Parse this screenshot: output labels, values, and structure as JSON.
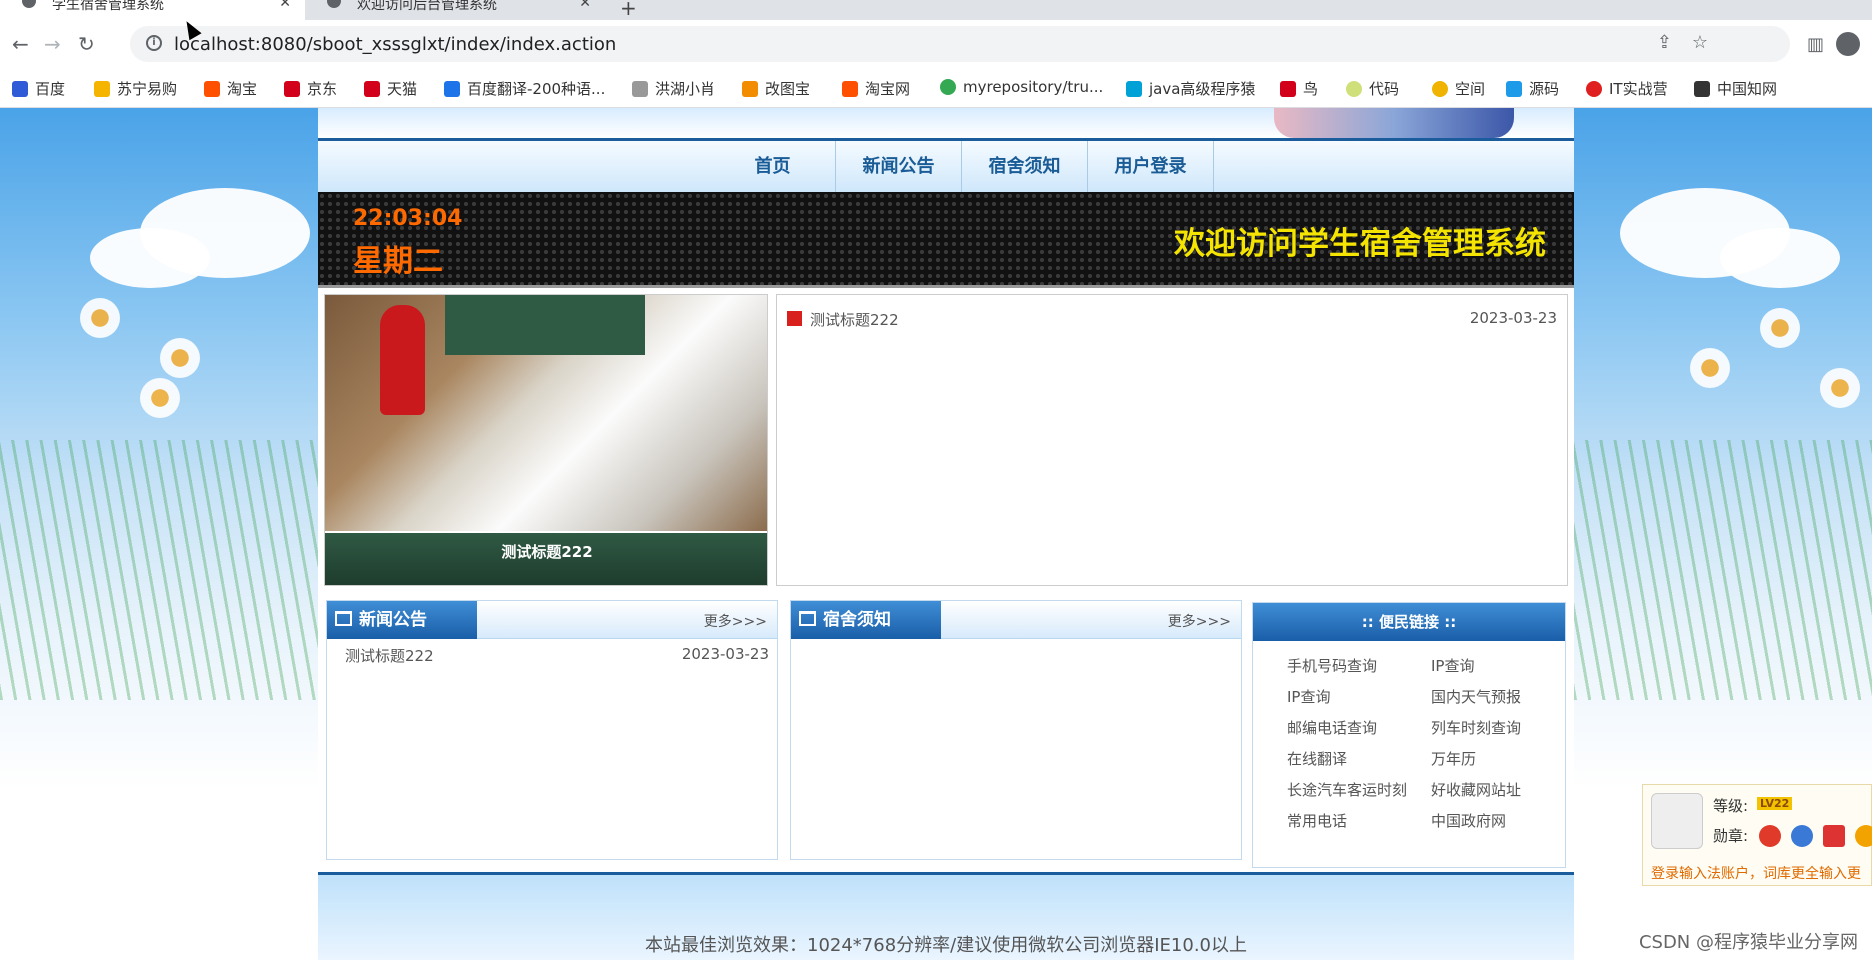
{
  "browser": {
    "tabs": [
      {
        "title": "学生宿舍管理系统",
        "close": "✕"
      },
      {
        "title": "欢迎访问后台管理系统",
        "close": "✕"
      }
    ],
    "newtab": "+",
    "url": "localhost:8080/sboot_xsssglxt/index/index.action",
    "bookmarks": [
      "百度",
      "苏宁易购",
      "淘宝",
      "京东",
      "天猫",
      "百度翻译-200种语...",
      "洪湖小肖",
      "改图宝",
      "淘宝网",
      "myrepository/tru...",
      "java高级程序猿",
      "鸟",
      "代码",
      "空间",
      "源码",
      "IT实战营",
      "中国知网"
    ]
  },
  "site": {
    "nav": [
      "首页",
      "新闻公告",
      "宿舍须知",
      "用户登录"
    ],
    "time": "22:03:04",
    "weekday": "星期二",
    "welcome": "欢迎访问学生宿舍管理系统",
    "slide_caption": "测试标题222",
    "top_news": {
      "title": "测试标题222",
      "date": "2023-03-23"
    },
    "news_box": {
      "title": "新闻公告",
      "more": "更多>>>",
      "items": [
        {
          "title": "测试标题222",
          "date": "2023-03-23"
        }
      ]
    },
    "notice_box": {
      "title": "宿舍须知",
      "more": "更多>>>"
    },
    "links_box": {
      "title": ":: 便民链接 ::",
      "links": [
        "手机号码查询",
        "IP查询",
        "IP查询",
        "国内天气预报",
        "邮编电话查询",
        "列车时刻查询",
        "在线翻译",
        "万年历",
        "长途汽车客运时刻",
        "好收藏网站址",
        "常用电话",
        "中国政府网"
      ]
    },
    "footer": "本站最佳浏览效果：1024*768分辨率/建议使用微软公司浏览器IE10.0以上"
  },
  "ime_popup": {
    "level_label": "等级:",
    "level": "LV22",
    "medal_label": "勋章:",
    "tip": "登录输入法账户，词库更全输入更"
  },
  "watermark": "CSDN @程序猿毕业分享网"
}
